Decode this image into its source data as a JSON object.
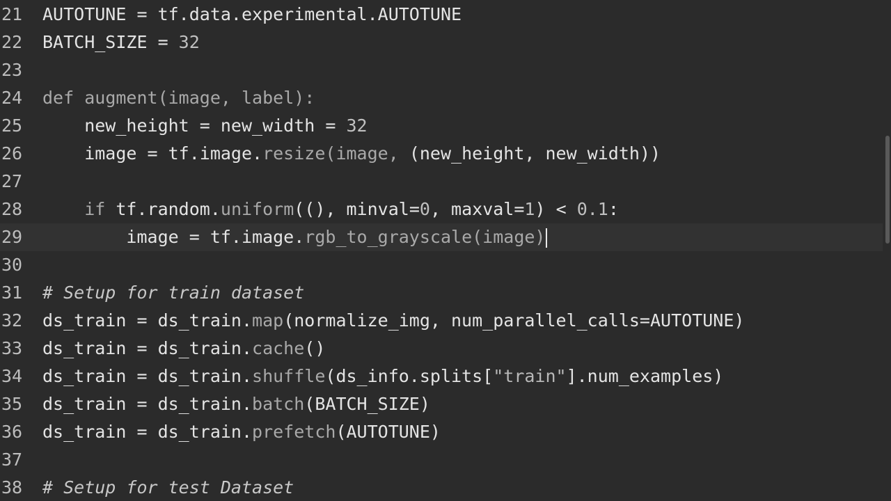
{
  "editor": {
    "lines": [
      {
        "num": "21",
        "current": false,
        "tokens": [
          {
            "t": "AUTOTUNE = tf.data.experimental.AUTOTUNE",
            "c": "default"
          }
        ]
      },
      {
        "num": "22",
        "current": false,
        "tokens": [
          {
            "t": "BATCH_SIZE = ",
            "c": "default"
          },
          {
            "t": "32",
            "c": "num"
          }
        ]
      },
      {
        "num": "23",
        "current": false,
        "tokens": []
      },
      {
        "num": "24",
        "current": false,
        "tokens": [
          {
            "t": "def ",
            "c": "kw"
          },
          {
            "t": "augment(image, label):",
            "c": "fn"
          }
        ]
      },
      {
        "num": "25",
        "current": false,
        "tokens": [
          {
            "t": "    new_height = new_width = ",
            "c": "default"
          },
          {
            "t": "32",
            "c": "num"
          }
        ]
      },
      {
        "num": "26",
        "current": false,
        "tokens": [
          {
            "t": "    image = tf.image.",
            "c": "default"
          },
          {
            "t": "resize",
            "c": "fn"
          },
          {
            "t": "(",
            "c": "fn"
          },
          {
            "t": "image, ",
            "c": "fn"
          },
          {
            "t": "(new_height, new_width))",
            "c": "default"
          }
        ]
      },
      {
        "num": "27",
        "current": false,
        "tokens": []
      },
      {
        "num": "28",
        "current": false,
        "tokens": [
          {
            "t": "    ",
            "c": "default"
          },
          {
            "t": "if ",
            "c": "kw"
          },
          {
            "t": "tf.random.",
            "c": "default"
          },
          {
            "t": "uniform",
            "c": "fn"
          },
          {
            "t": "((), minval=",
            "c": "default"
          },
          {
            "t": "0",
            "c": "num"
          },
          {
            "t": ", maxval=",
            "c": "default"
          },
          {
            "t": "1",
            "c": "num"
          },
          {
            "t": ") < ",
            "c": "default"
          },
          {
            "t": "0.1",
            "c": "num"
          },
          {
            "t": ":",
            "c": "default"
          }
        ]
      },
      {
        "num": "29",
        "current": true,
        "tokens": [
          {
            "t": "        image = tf.image.",
            "c": "default"
          },
          {
            "t": "rgb_to_grayscale",
            "c": "fn"
          },
          {
            "t": "(image)",
            "c": "fn"
          }
        ]
      },
      {
        "num": "30",
        "current": false,
        "tokens": []
      },
      {
        "num": "31",
        "current": false,
        "tokens": [
          {
            "t": "# Setup for train dataset",
            "c": "comment"
          }
        ]
      },
      {
        "num": "32",
        "current": false,
        "tokens": [
          {
            "t": "ds_train = ds_train.",
            "c": "default"
          },
          {
            "t": "map",
            "c": "fn"
          },
          {
            "t": "(normalize_img, num_parallel_calls=AUTOTUNE)",
            "c": "default"
          }
        ]
      },
      {
        "num": "33",
        "current": false,
        "tokens": [
          {
            "t": "ds_train = ds_train.",
            "c": "default"
          },
          {
            "t": "cache",
            "c": "fn"
          },
          {
            "t": "()",
            "c": "default"
          }
        ]
      },
      {
        "num": "34",
        "current": false,
        "tokens": [
          {
            "t": "ds_train = ds_train.",
            "c": "default"
          },
          {
            "t": "shuffle",
            "c": "fn"
          },
          {
            "t": "(ds_info.splits[",
            "c": "default"
          },
          {
            "t": "\"train\"",
            "c": "str"
          },
          {
            "t": "].num_examples)",
            "c": "default"
          }
        ]
      },
      {
        "num": "35",
        "current": false,
        "tokens": [
          {
            "t": "ds_train = ds_train.",
            "c": "default"
          },
          {
            "t": "batch",
            "c": "fn"
          },
          {
            "t": "(BATCH_SIZE)",
            "c": "default"
          }
        ]
      },
      {
        "num": "36",
        "current": false,
        "tokens": [
          {
            "t": "ds_train = ds_train.",
            "c": "default"
          },
          {
            "t": "prefetch",
            "c": "fn"
          },
          {
            "t": "(AUTOTUNE)",
            "c": "default"
          }
        ]
      },
      {
        "num": "37",
        "current": false,
        "tokens": []
      },
      {
        "num": "38",
        "current": false,
        "tokens": [
          {
            "t": "# Setup for test Dataset",
            "c": "comment"
          }
        ]
      }
    ]
  },
  "colors": {
    "background": "#2b2b2b",
    "current_line": "#323232",
    "text": "#e4e4e4",
    "line_number": "#bdbdbd"
  }
}
